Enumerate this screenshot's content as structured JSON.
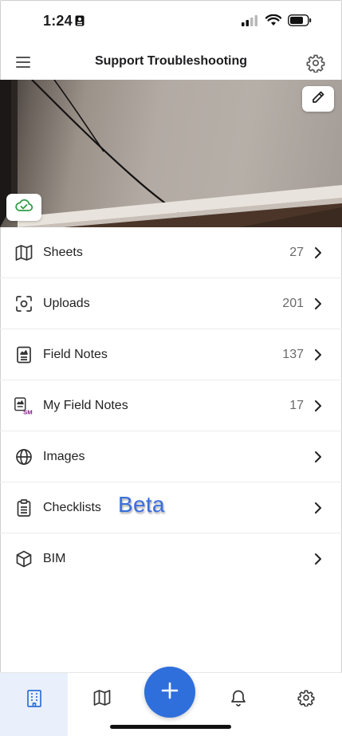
{
  "status_bar": {
    "time": "1:24",
    "icons": [
      "cellular-signal-icon",
      "wifi-icon",
      "battery-icon"
    ]
  },
  "header": {
    "title": "Support Troubleshooting",
    "left_icon": "hamburger-menu-icon",
    "right_icon": "gear-icon"
  },
  "cover": {
    "edit_icon": "pencil-icon",
    "sync_icon": "cloud-check-icon"
  },
  "menu": [
    {
      "label": "Sheets",
      "count": "27",
      "icon": "map-icon"
    },
    {
      "label": "Uploads",
      "count": "201",
      "icon": "camera-frame-icon"
    },
    {
      "label": "Field Notes",
      "count": "137",
      "icon": "document-icon"
    },
    {
      "label": "My Field Notes",
      "count": "17",
      "icon": "my-document-icon",
      "icon_badge": "SM"
    },
    {
      "label": "Images",
      "count": "",
      "icon": "globe-icon"
    },
    {
      "label": "Checklists",
      "count": "",
      "icon": "clipboard-icon",
      "tag": "Beta"
    },
    {
      "label": "BIM",
      "count": "",
      "icon": "cube-icon"
    }
  ],
  "bottom_nav": {
    "tabs": [
      "building-icon",
      "map-icon",
      "plus-icon",
      "bell-icon",
      "gear-icon"
    ],
    "active": "building-icon"
  },
  "colors": {
    "accent": "#2f6fdc",
    "active_tab_bg": "#eaf0fb",
    "beta_text": "#3a6ee0",
    "sync_green": "#2e9e48",
    "badge_purple": "#8a1c8a"
  }
}
